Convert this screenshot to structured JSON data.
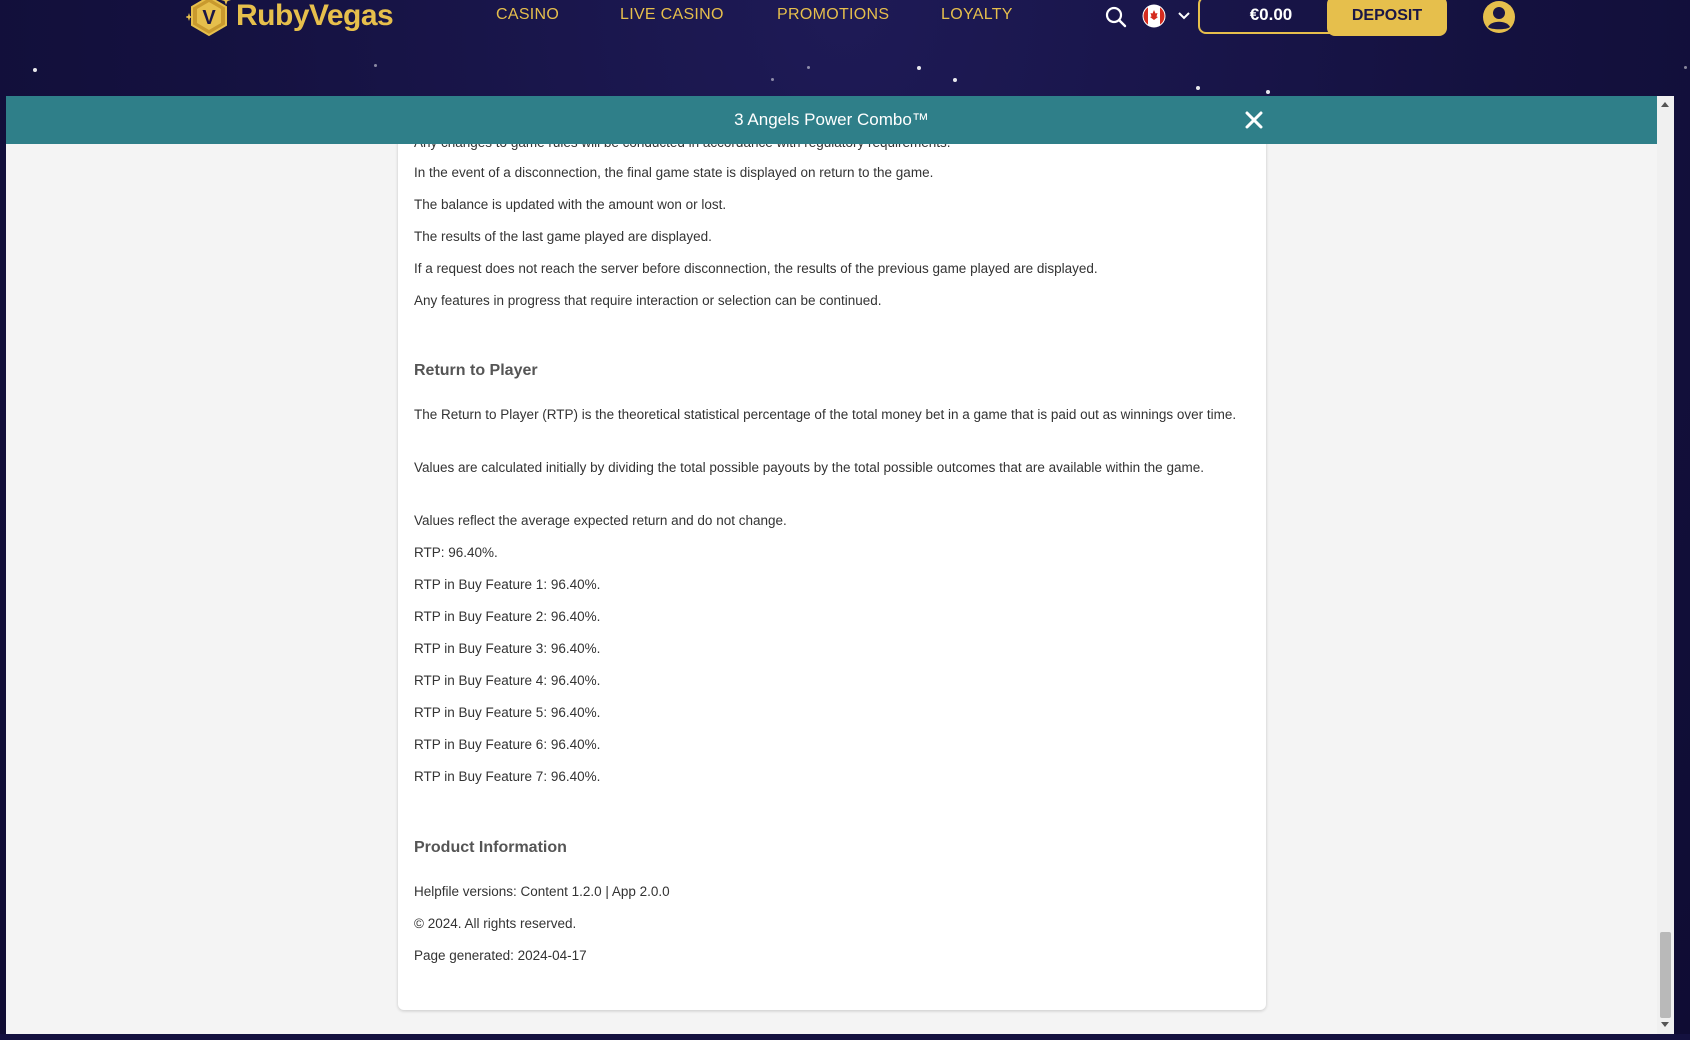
{
  "brand": {
    "name": "RubyVegas",
    "logo_letter": "V"
  },
  "nav": {
    "items": [
      {
        "label": "CASINO"
      },
      {
        "label": "LIVE CASINO"
      },
      {
        "label": "PROMOTIONS"
      },
      {
        "label": "LOYALTY"
      }
    ]
  },
  "header": {
    "search_icon": "search-icon",
    "flag_icon": "canada-flag-icon",
    "balance": "€0.00",
    "deposit_label": "DEPOSIT",
    "account_icon": "user-account-icon"
  },
  "modal": {
    "title": "3 Angels Power Combo™",
    "close_icon": "close-icon",
    "partial_top_line": "Any changes to game rules will be conducted in accordance with regulatory requirements.",
    "disconnection_paragraphs": [
      "In the event of a disconnection, the final game state is displayed on return to the game.",
      "The balance is updated with the amount won or lost.",
      "The results of the last game played are displayed.",
      "If a request does not reach the server before disconnection, the results of the previous game played are displayed.",
      "Any features in progress that require interaction or selection can be continued."
    ],
    "rtp_heading": "Return to Player",
    "rtp_paragraphs": [
      "The Return to Player (RTP) is the theoretical statistical percentage of the total money bet in a game that is paid out as winnings over time.",
      "Values are calculated initially by dividing the total possible payouts by the total possible outcomes that are available within the game.",
      "Values reflect the average expected return and do not change.",
      "RTP: 96.40%.",
      "RTP in Buy Feature 1: 96.40%.",
      "RTP in Buy Feature 2: 96.40%.",
      "RTP in Buy Feature 3: 96.40%.",
      "RTP in Buy Feature 4: 96.40%.",
      "RTP in Buy Feature 5: 96.40%.",
      "RTP in Buy Feature 6: 96.40%.",
      "RTP in Buy Feature 7: 96.40%."
    ],
    "product_heading": "Product Information",
    "product_paragraphs": [
      "Helpfile versions: Content 1.2.0 | App 2.0.0",
      "© 2024. All rights reserved.",
      "Page generated: 2024-04-17"
    ]
  },
  "colors": {
    "background": "#14113f",
    "gold": "#e6bf4c",
    "modal_bar": "#2f7f89",
    "panel_bg": "#f4f4f4",
    "text": "#333333"
  }
}
